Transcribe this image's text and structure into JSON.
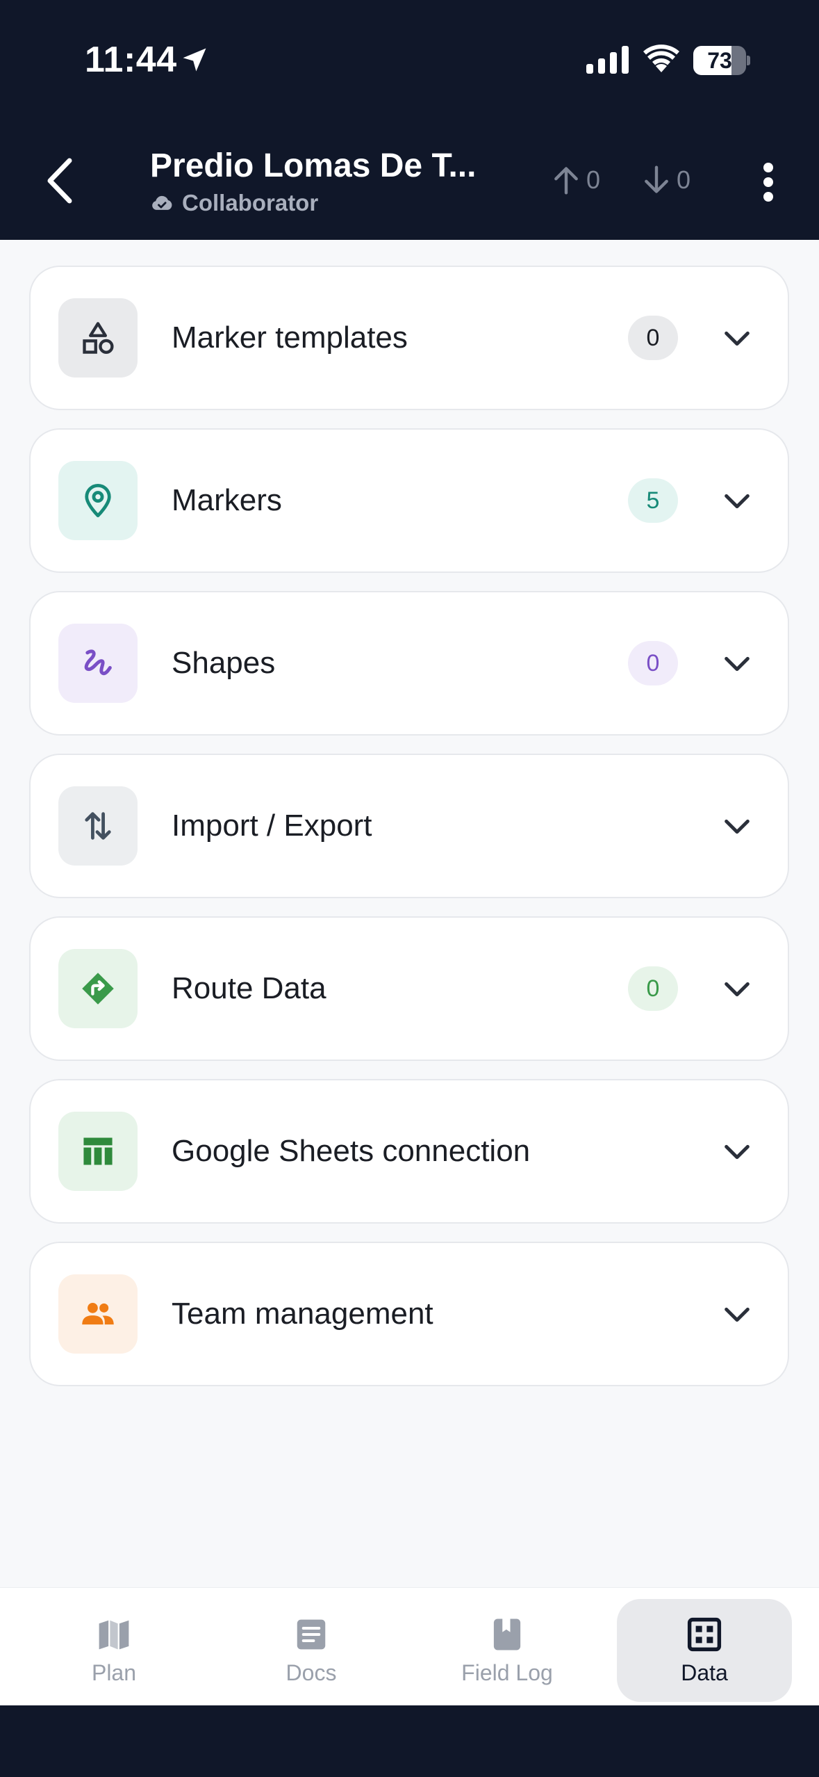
{
  "status_bar": {
    "time": "11:44",
    "battery": "73",
    "battery_level": 0.73
  },
  "header": {
    "title": "Predio Lomas De T...",
    "role": "Collaborator",
    "upload_count": "0",
    "download_count": "0"
  },
  "sections": [
    {
      "label": "Marker templates",
      "badge": "0",
      "icon": "shapes-icon",
      "color": "#2a2f3a",
      "bg": "#e9eaec",
      "badge_bg": "#e9eaec",
      "badge_color": "#1a1d24"
    },
    {
      "label": "Markers",
      "badge": "5",
      "icon": "map-pin-icon",
      "color": "#178a78",
      "bg": "#e3f4f1",
      "badge_bg": "#e3f4f1",
      "badge_color": "#178a78"
    },
    {
      "label": "Shapes",
      "badge": "0",
      "icon": "scribble-icon",
      "color": "#7a4fc6",
      "bg": "#f1ecfa",
      "badge_bg": "#f1ecfa",
      "badge_color": "#7a4fc6"
    },
    {
      "label": "Import / Export",
      "badge": "",
      "icon": "import-export-icon",
      "color": "#43505f",
      "bg": "#eceef0"
    },
    {
      "label": "Route Data",
      "badge": "0",
      "icon": "route-sign-icon",
      "color": "#3a9a4a",
      "bg": "#e7f4e9",
      "badge_bg": "#e7f4e9",
      "badge_color": "#3a9a4a"
    },
    {
      "label": "Google Sheets connection",
      "badge": "",
      "icon": "sheets-icon",
      "color": "#2f8a3c",
      "bg": "#e7f4e9"
    },
    {
      "label": "Team management",
      "badge": "",
      "icon": "people-icon",
      "color": "#f07c14",
      "bg": "#fdf0e5"
    }
  ],
  "nav": [
    {
      "label": "Plan",
      "icon": "map-icon",
      "active": false
    },
    {
      "label": "Docs",
      "icon": "document-icon",
      "active": false
    },
    {
      "label": "Field Log",
      "icon": "bookmark-book-icon",
      "active": false
    },
    {
      "label": "Data",
      "icon": "grid-icon",
      "active": true
    }
  ]
}
